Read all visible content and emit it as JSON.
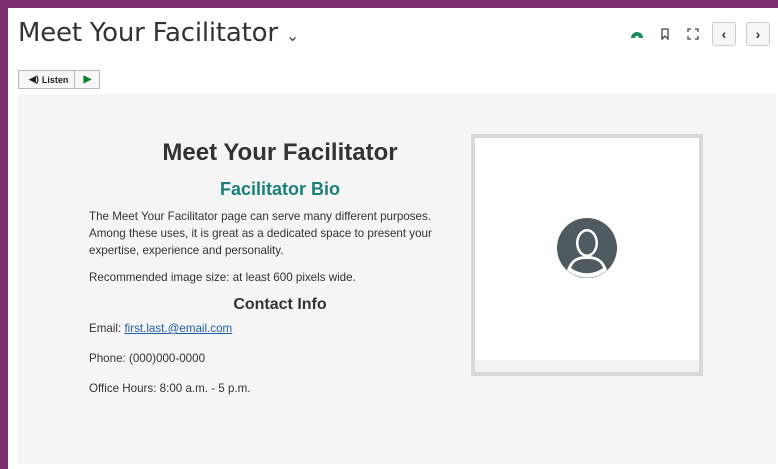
{
  "header": {
    "title": "Meet Your Facilitator",
    "title_chevron": "⌄",
    "tools": [
      {
        "name": "progress-icon",
        "glyph": "◓"
      },
      {
        "name": "bookmark-icon",
        "glyph": "▯"
      },
      {
        "name": "fullscreen-icon",
        "glyph": "⛶"
      }
    ],
    "prev": "‹",
    "next": "›"
  },
  "listen": {
    "label": "Listen",
    "speaker": "◀)",
    "play": "▶"
  },
  "content": {
    "heading": "Meet Your Facilitator",
    "subheading": "Facilitator Bio",
    "bio": "The Meet Your Facilitator page can serve many different purposes. Among these uses, it is great as a dedicated space to present your expertise, experience and personality.",
    "image_note": "Recommended image size: at least 600 pixels wide.",
    "contact_heading": "Contact Info",
    "email_label": "Email: ",
    "email_value": "first.last.@email.com",
    "phone": "Phone: (000)000-0000",
    "office_hours": "Office Hours: 8:00 a.m. - 5 p.m."
  },
  "colors": {
    "frame": "#7a2d6e",
    "accent_heading": "#1a7f7a",
    "link": "#1f5fa8",
    "progress_icon": "#1a8a5a",
    "avatar": "#505a61"
  }
}
